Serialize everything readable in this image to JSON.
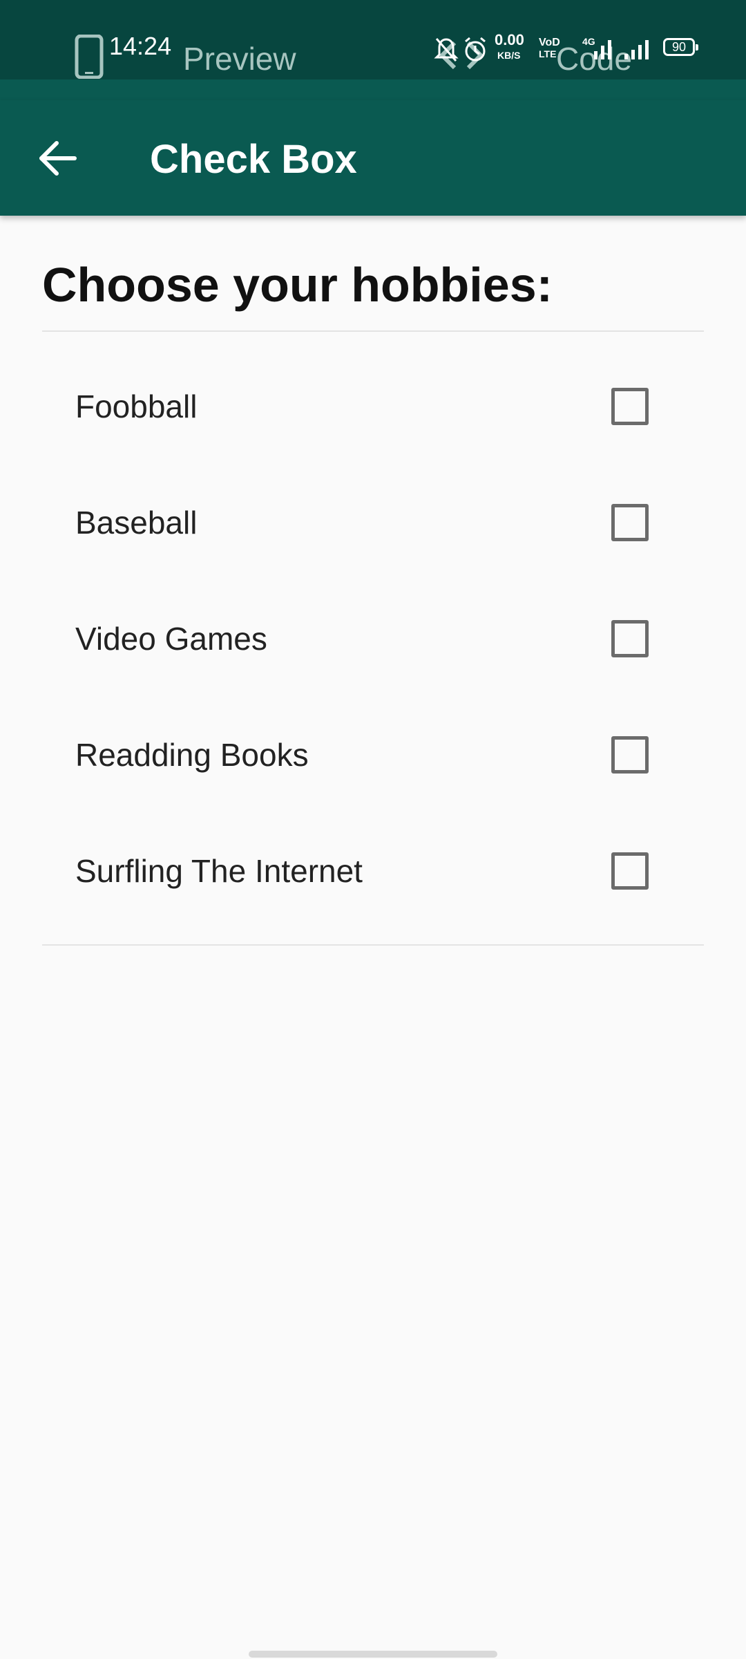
{
  "status_bar": {
    "time": "14:24",
    "speed_value": "0.00",
    "speed_unit": "KB/S",
    "volte_top": "VoD",
    "volte_bottom": "LTE",
    "network_type": "4G",
    "battery_level": "90",
    "preview_label": "Preview",
    "code_label": "Code"
  },
  "app_bar": {
    "title": "Check Box",
    "back_icon": "arrow-left-icon"
  },
  "main": {
    "heading": "Choose your hobbies:",
    "hobbies": [
      {
        "label": "Foobball",
        "checked": false
      },
      {
        "label": "Baseball",
        "checked": false
      },
      {
        "label": "Video Games",
        "checked": false
      },
      {
        "label": "Readding Books",
        "checked": false
      },
      {
        "label": "Surfling The Internet",
        "checked": false
      }
    ]
  },
  "colors": {
    "status_bar": "#07463f",
    "app_bar": "#0a5a51",
    "background": "#fafafa",
    "checkbox_border": "#6b6b6b"
  }
}
